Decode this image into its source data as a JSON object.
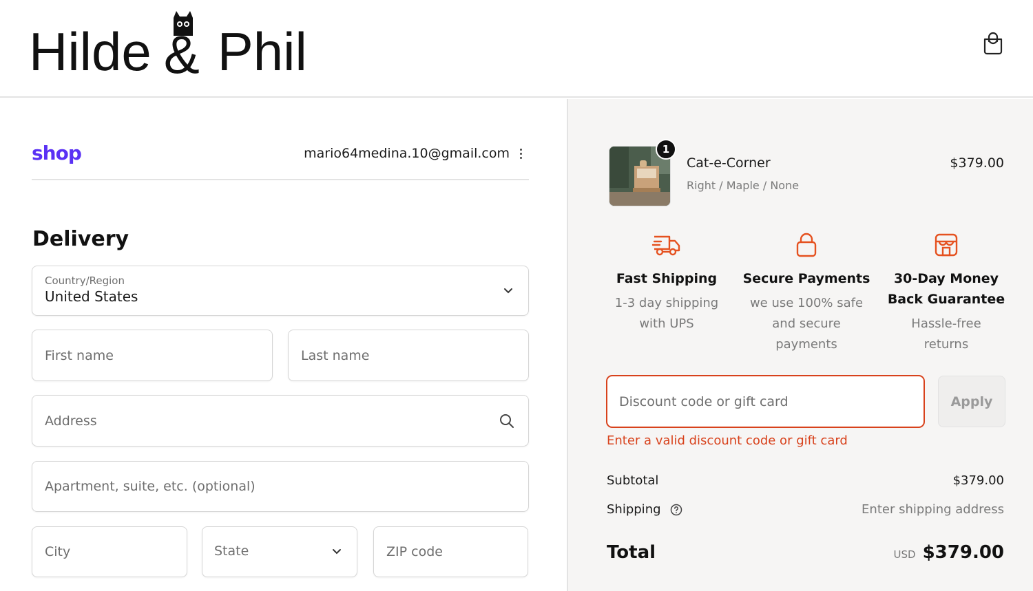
{
  "header": {
    "logo": {
      "left_word": "Hilde",
      "ampersand": "&",
      "right_word": "Phil"
    },
    "bag_icon": "shopping-bag-icon"
  },
  "account": {
    "shop_logo": "shop",
    "email": "mario64medina.10@gmail.com",
    "menu_icon": "kebab-menu-icon"
  },
  "delivery": {
    "title": "Delivery",
    "country": {
      "label": "Country/Region",
      "value": "United States"
    },
    "first_name": {
      "placeholder": "First name"
    },
    "last_name": {
      "placeholder": "Last name"
    },
    "address": {
      "placeholder": "Address"
    },
    "apartment": {
      "placeholder": "Apartment, suite, etc. (optional)"
    },
    "city": {
      "placeholder": "City"
    },
    "state": {
      "value": "State"
    },
    "zip": {
      "placeholder": "ZIP code"
    }
  },
  "cart": {
    "item": {
      "name": "Cat-e-Corner",
      "variant": "Right / Maple / None",
      "price": "$379.00",
      "quantity": "1"
    }
  },
  "features": [
    {
      "icon": "delivery-truck-icon",
      "title": "Fast Shipping",
      "desc_line1": "1-3 day shipping",
      "desc_line2": "with UPS",
      "desc_line3": ""
    },
    {
      "icon": "lock-icon",
      "title": "Secure Payments",
      "desc_line1": "we use 100% safe",
      "desc_line2": "and secure",
      "desc_line3": "payments"
    },
    {
      "icon": "store-icon",
      "title_line1": "30-Day Money",
      "title_line2": "Back Guarantee",
      "desc_line1": "Hassle-free",
      "desc_line2": "returns"
    }
  ],
  "discount": {
    "placeholder": "Discount code or gift card",
    "apply_label": "Apply",
    "error": "Enter a valid discount code or gift card"
  },
  "summary": {
    "subtotal_label": "Subtotal",
    "subtotal_value": "$379.00",
    "shipping_label": "Shipping",
    "shipping_value": "Enter shipping address",
    "total_label": "Total",
    "currency": "USD",
    "total_value": "$379.00"
  },
  "colors": {
    "accent_error": "#d8421c",
    "shop_brand": "#5a31f4",
    "sidebar_bg": "#f6f5f4"
  }
}
